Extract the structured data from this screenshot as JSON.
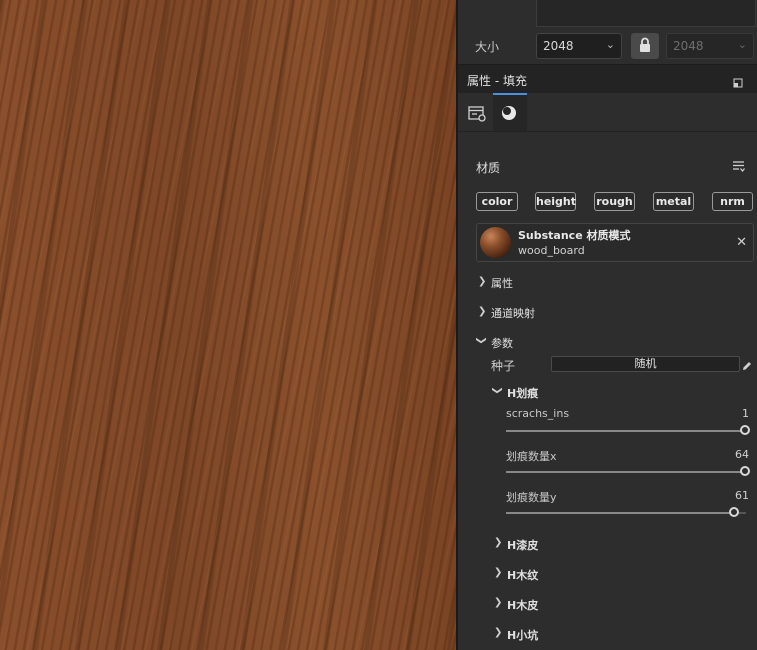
{
  "size": {
    "label": "大小",
    "value": "2048",
    "value_locked": "2048"
  },
  "panel": {
    "title": "属性 - 填充"
  },
  "material": {
    "title": "材质",
    "channels": [
      "color",
      "height",
      "rough",
      "metal",
      "nrm"
    ],
    "substance": {
      "title": "Substance 材质模式",
      "name": "wood_board"
    }
  },
  "sections": {
    "attributes": "属性",
    "channel_mapping": "通道映射",
    "params": "参数"
  },
  "seed": {
    "label": "种子",
    "value": "随机"
  },
  "group_scratch": {
    "title": "H划痕",
    "params": [
      {
        "name": "scrachs_ins",
        "value": "1",
        "fraction": 1.0
      },
      {
        "name": "划痕数量x",
        "value": "64",
        "fraction": 1.0
      },
      {
        "name": "划痕数量y",
        "value": "61",
        "fraction": 0.953
      }
    ]
  },
  "groups_collapsed": [
    "H漆皮",
    "H木纹",
    "H木皮",
    "H小坑"
  ],
  "colors": {
    "accent": "#4a90e2",
    "panel_bg": "#2d2d2d",
    "wood": "#8a4f2c"
  }
}
